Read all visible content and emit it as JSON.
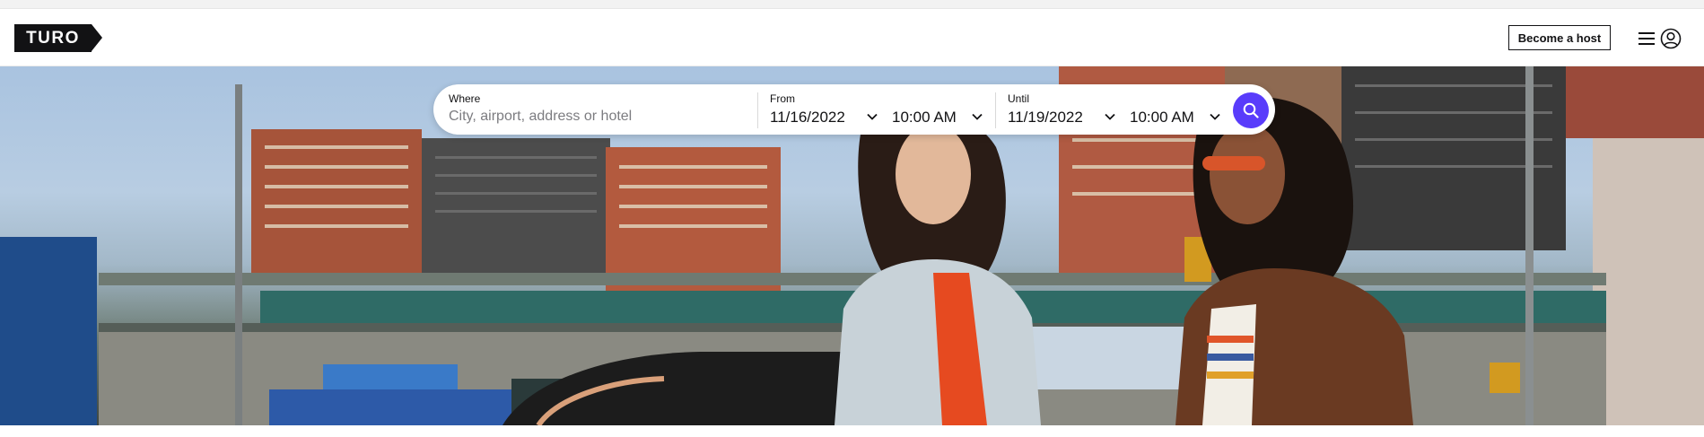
{
  "logo": {
    "text": "TURO"
  },
  "header": {
    "host_button": "Become a host"
  },
  "search": {
    "where_label": "Where",
    "where_placeholder": "City, airport, address or hotel",
    "from_label": "From",
    "from_date": "11/16/2022",
    "from_time": "10:00 AM",
    "until_label": "Until",
    "until_date": "11/19/2022",
    "until_time": "10:00 AM"
  },
  "colors": {
    "brand_dark": "#121214",
    "accent_purple": "#593cfb"
  },
  "icons": {
    "menu": "hamburger-icon",
    "profile": "user-circle-icon",
    "chevron": "chevron-down-icon",
    "search": "search-icon"
  }
}
